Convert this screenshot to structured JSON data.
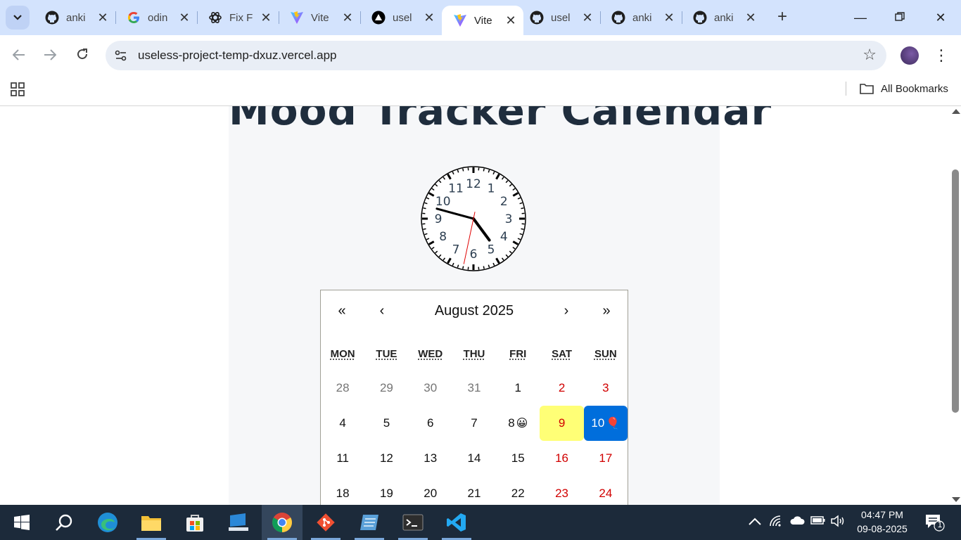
{
  "browser": {
    "tabs": [
      {
        "title": "anki",
        "favicon": "github-icon"
      },
      {
        "title": "odin",
        "favicon": "google-icon"
      },
      {
        "title": "Fix F",
        "favicon": "openai-icon"
      },
      {
        "title": "Vite",
        "favicon": "vite-icon"
      },
      {
        "title": "usel",
        "favicon": "vercel-icon"
      },
      {
        "title": "Vite",
        "favicon": "vite-icon",
        "active": true
      },
      {
        "title": "usel",
        "favicon": "github-icon"
      },
      {
        "title": "anki",
        "favicon": "github-icon"
      },
      {
        "title": "anki",
        "favicon": "github-icon"
      }
    ],
    "url": "useless-project-temp-dxuz.vercel.app",
    "bookmarks_label": "All Bookmarks"
  },
  "page": {
    "title": "Mood Tracker Calendar",
    "clock": {
      "numbers": [
        "12",
        "1",
        "2",
        "3",
        "4",
        "5",
        "6",
        "7",
        "8",
        "9",
        "10",
        "11"
      ],
      "hour": 4,
      "minute": 47,
      "second": 32
    },
    "calendar": {
      "nav": {
        "prev2": "«",
        "prev": "‹",
        "label": "August 2025",
        "next": "›",
        "next2": "»"
      },
      "weekdays": [
        "MON",
        "TUE",
        "WED",
        "THU",
        "FRI",
        "SAT",
        "SUN"
      ],
      "weeks": [
        [
          {
            "d": "28",
            "n": true
          },
          {
            "d": "29",
            "n": true
          },
          {
            "d": "30",
            "n": true
          },
          {
            "d": "31",
            "n": true
          },
          {
            "d": "1"
          },
          {
            "d": "2",
            "w": true
          },
          {
            "d": "3",
            "w": true
          }
        ],
        [
          {
            "d": "4"
          },
          {
            "d": "5"
          },
          {
            "d": "6"
          },
          {
            "d": "7"
          },
          {
            "d": "8",
            "emoji": "😀"
          },
          {
            "d": "9",
            "w": true,
            "hl": true
          },
          {
            "d": "10",
            "w": true,
            "active": true,
            "emoji": "🎈"
          }
        ],
        [
          {
            "d": "11"
          },
          {
            "d": "12"
          },
          {
            "d": "13"
          },
          {
            "d": "14"
          },
          {
            "d": "15"
          },
          {
            "d": "16",
            "w": true
          },
          {
            "d": "17",
            "w": true
          }
        ],
        [
          {
            "d": "18"
          },
          {
            "d": "19"
          },
          {
            "d": "20"
          },
          {
            "d": "21"
          },
          {
            "d": "22"
          },
          {
            "d": "23",
            "w": true
          },
          {
            "d": "24",
            "w": true
          }
        ]
      ]
    }
  },
  "taskbar": {
    "apps": [
      "windows-start-icon",
      "search-icon",
      "edge-icon",
      "file-explorer-icon",
      "microsoft-store-icon",
      "remote-desktop-icon",
      "chrome-icon",
      "git-icon",
      "notepad-icon",
      "terminal-icon",
      "vscode-icon"
    ],
    "time": "04:47 PM",
    "date": "09-08-2025",
    "notification_count": "1"
  },
  "colors": {
    "tabstrip": "#d3e3fd",
    "calendar_active": "#006edc",
    "calendar_highlight": "#ffff76",
    "weekend": "#d10000",
    "title": "#1f2d3d"
  }
}
